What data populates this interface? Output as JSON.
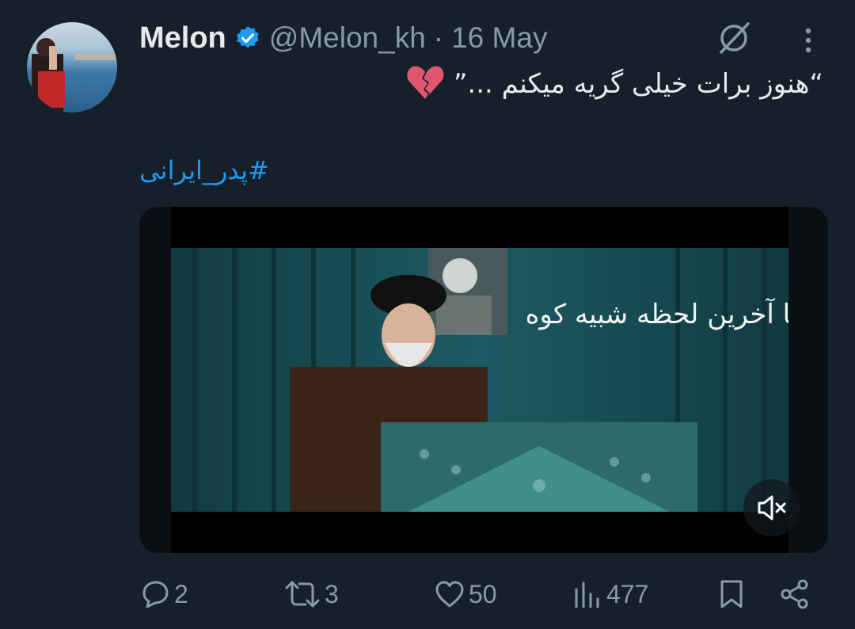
{
  "author": {
    "name": "Melon",
    "handle": "@Melon_kh",
    "separator": "·",
    "date": "16 May",
    "verified": true,
    "avatar_icon": "avatar"
  },
  "tweet": {
    "text": "“هنوز برات خیلی گریه میکنم ...”",
    "emoji_icon": "broken-heart-icon",
    "hashtag": "#پدر_ایرانی"
  },
  "media": {
    "type": "video",
    "caption_overlay": "تا آخرین لحظه شبیه کوه",
    "mute_icon": "volume-muted-icon"
  },
  "actions": {
    "replies": "2",
    "reposts": "3",
    "likes": "50",
    "views": "477"
  },
  "colors": {
    "background": "#15202b",
    "text": "#e7e9ea",
    "secondary": "#8b98a5",
    "accent": "#1d9bf0"
  }
}
